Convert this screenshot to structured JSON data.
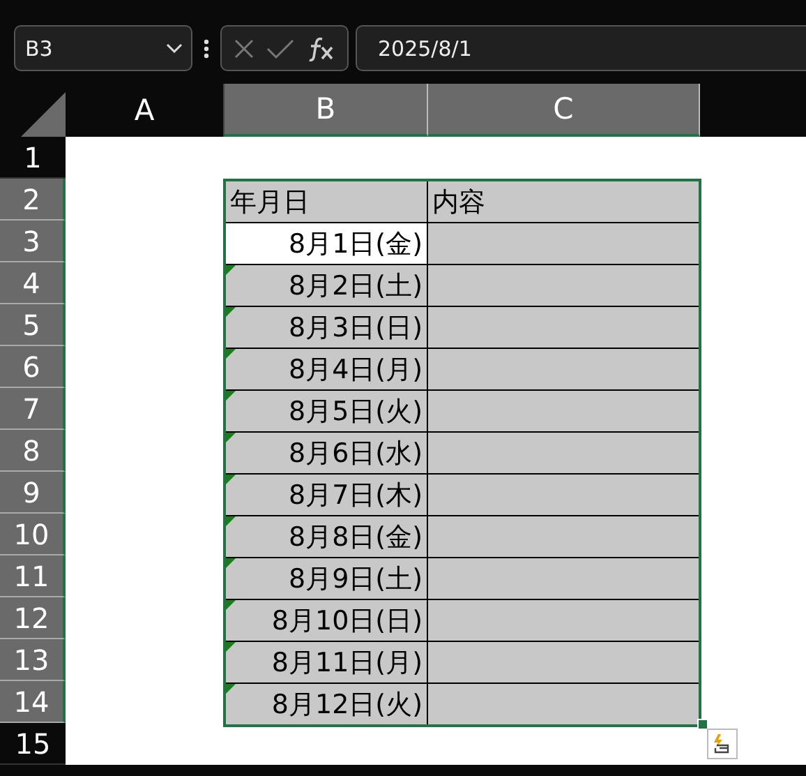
{
  "name_box": {
    "value": "B3"
  },
  "formula_bar": {
    "value": "2025/8/1"
  },
  "columns": [
    {
      "label": "A",
      "selected": false
    },
    {
      "label": "B",
      "selected": true
    },
    {
      "label": "C",
      "selected": true
    }
  ],
  "rows": [
    {
      "label": "1",
      "selected": false
    },
    {
      "label": "2",
      "selected": true
    },
    {
      "label": "3",
      "selected": true
    },
    {
      "label": "4",
      "selected": true
    },
    {
      "label": "5",
      "selected": true
    },
    {
      "label": "6",
      "selected": true
    },
    {
      "label": "7",
      "selected": true
    },
    {
      "label": "8",
      "selected": true
    },
    {
      "label": "9",
      "selected": true
    },
    {
      "label": "10",
      "selected": true
    },
    {
      "label": "11",
      "selected": true
    },
    {
      "label": "12",
      "selected": true
    },
    {
      "label": "13",
      "selected": true
    },
    {
      "label": "14",
      "selected": true
    },
    {
      "label": "15",
      "selected": false
    }
  ],
  "table": {
    "headers": [
      "年月日",
      "内容"
    ],
    "rows": [
      {
        "date": "8月1日(金)",
        "active": true,
        "error_flag": false
      },
      {
        "date": "8月2日(土)",
        "active": false,
        "error_flag": true
      },
      {
        "date": "8月3日(日)",
        "active": false,
        "error_flag": true
      },
      {
        "date": "8月4日(月)",
        "active": false,
        "error_flag": true
      },
      {
        "date": "8月5日(火)",
        "active": false,
        "error_flag": true
      },
      {
        "date": "8月6日(水)",
        "active": false,
        "error_flag": true
      },
      {
        "date": "8月7日(木)",
        "active": false,
        "error_flag": true
      },
      {
        "date": "8月8日(金)",
        "active": false,
        "error_flag": true
      },
      {
        "date": "8月9日(土)",
        "active": false,
        "error_flag": true
      },
      {
        "date": "8月10日(日)",
        "active": false,
        "error_flag": true
      },
      {
        "date": "8月11日(月)",
        "active": false,
        "error_flag": true
      },
      {
        "date": "8月12日(火)",
        "active": false,
        "error_flag": true
      }
    ]
  }
}
